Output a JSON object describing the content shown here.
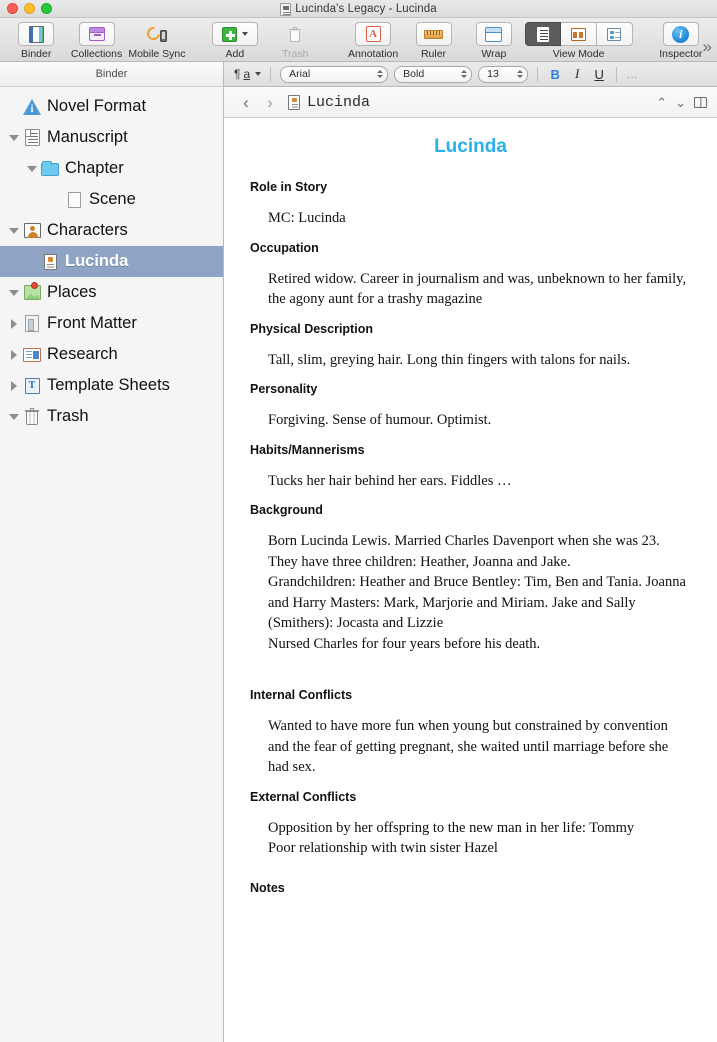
{
  "window": {
    "title": "Lucinda's Legacy - Lucinda",
    "title_icon": "document-icon",
    "traffic_lights": [
      "close-red",
      "minimize-yellow",
      "zoom-green"
    ]
  },
  "toolbar": {
    "items": [
      {
        "label": "Binder",
        "icon": "binder-icon",
        "enabled": true
      },
      {
        "label": "Collections",
        "icon": "collections-icon",
        "enabled": true
      },
      {
        "label": "Mobile Sync",
        "icon": "mobile-sync-icon",
        "enabled": true
      },
      {
        "label": "Add",
        "icon": "add-plus-icon",
        "enabled": true
      },
      {
        "label": "Trash",
        "icon": "trash-icon",
        "enabled": false
      },
      {
        "label": "Annotation",
        "icon": "annotation-icon",
        "enabled": true
      },
      {
        "label": "Ruler",
        "icon": "ruler-icon",
        "enabled": true
      },
      {
        "label": "Wrap",
        "icon": "wrap-icon",
        "enabled": true
      },
      {
        "label": "View Mode",
        "icon": "view-mode-group",
        "enabled": true
      },
      {
        "label": "Inspector",
        "icon": "inspector-info-icon",
        "enabled": true
      }
    ],
    "view_mode": {
      "label": "View Mode",
      "segments": [
        "document-view",
        "corkboard-view",
        "outliner-view"
      ],
      "active_index": 0
    },
    "overflow_label": "»"
  },
  "format_bar": {
    "paragraph_style_glyph": "¶a",
    "font_family": "Arial",
    "font_style": "Bold",
    "font_size": "13",
    "bold_label": "B",
    "italic_label": "I",
    "underline_label": "U",
    "more_label": "…"
  },
  "binder": {
    "header": "Binder",
    "selection_color": "#8fa4c4",
    "items": [
      {
        "label": "Novel Format",
        "icon": "novel-format-icon",
        "indent": 0,
        "disclosure": "none",
        "selected": false
      },
      {
        "label": "Manuscript",
        "icon": "manuscript-icon",
        "indent": 0,
        "disclosure": "expanded",
        "selected": false
      },
      {
        "label": "Chapter",
        "icon": "folder-icon",
        "indent": 1,
        "disclosure": "expanded",
        "selected": false
      },
      {
        "label": "Scene",
        "icon": "scene-document-icon",
        "indent": 2,
        "disclosure": "none",
        "selected": false
      },
      {
        "label": "Characters",
        "icon": "characters-icon",
        "indent": 0,
        "disclosure": "expanded",
        "selected": false
      },
      {
        "label": "Lucinda",
        "icon": "character-card-icon",
        "indent": 1,
        "disclosure": "none",
        "selected": true
      },
      {
        "label": "Places",
        "icon": "places-icon",
        "indent": 0,
        "disclosure": "expanded",
        "selected": false
      },
      {
        "label": "Front Matter",
        "icon": "front-matter-icon",
        "indent": 0,
        "disclosure": "collapsed",
        "selected": false
      },
      {
        "label": "Research",
        "icon": "research-icon",
        "indent": 0,
        "disclosure": "collapsed",
        "selected": false
      },
      {
        "label": "Template Sheets",
        "icon": "template-sheets-icon",
        "indent": 0,
        "disclosure": "collapsed",
        "selected": false
      },
      {
        "label": "Trash",
        "icon": "trash-bin-icon",
        "indent": 0,
        "disclosure": "expanded",
        "selected": false
      }
    ]
  },
  "editor_header": {
    "back_arrow": "‹",
    "forward_arrow": "›",
    "doc_icon": "character-card-icon",
    "title": "Lucinda",
    "up_chevron": "⌃",
    "down_chevron": "⌄",
    "split_icon": "split-view-icon"
  },
  "document": {
    "title": "Lucinda",
    "title_color": "#2ab0e8",
    "sections": [
      {
        "heading": "Role in Story",
        "lines": [
          "MC: Lucinda"
        ]
      },
      {
        "heading": "Occupation",
        "lines": [
          "Retired widow. Career in journalism and was, unbeknown to her family, the agony aunt for a trashy magazine"
        ]
      },
      {
        "heading": "Physical Description",
        "lines": [
          "Tall, slim, greying hair.  Long thin fingers with talons for nails."
        ]
      },
      {
        "heading": "Personality",
        "lines": [
          "Forgiving. Sense of humour. Optimist."
        ]
      },
      {
        "heading": "Habits/Mannerisms",
        "lines": [
          "Tucks her hair behind her ears. Fiddles …"
        ]
      },
      {
        "heading": "Background",
        "lines": [
          "Born Lucinda Lewis. Married Charles Davenport when she was 23.",
          "They have three children: Heather, Joanna and Jake.",
          "Grandchildren: Heather and  Bruce Bentley: Tim, Ben and Tania. Joanna and Harry Masters: Mark, Marjorie and Miriam. Jake and Sally (Smithers): Jocasta and Lizzie",
          "Nursed Charles for four years before his death."
        ]
      },
      {
        "heading": "Internal Conflicts",
        "lines": [
          "Wanted to have more fun when young but constrained by convention and the fear of getting pregnant, she waited until marriage before she had sex."
        ]
      },
      {
        "heading": "External Conflicts",
        "lines": [
          "Opposition by her offspring to the new man in her life: Tommy",
          "Poor relationship with twin sister Hazel"
        ]
      },
      {
        "heading": "Notes",
        "lines": []
      }
    ]
  }
}
